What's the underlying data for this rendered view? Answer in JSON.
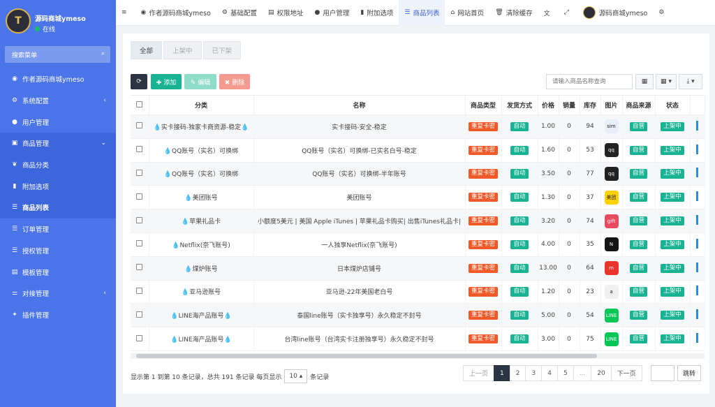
{
  "sidebar": {
    "username": "源码商城ymeso",
    "status": "在线",
    "search_placeholder": "搜索菜单",
    "items": [
      {
        "label": "作者源码商城ymeso",
        "icon": "dashboard-icon",
        "glyph": "◉"
      },
      {
        "label": "系统配置",
        "icon": "gear-icon",
        "glyph": "⚙",
        "chevron": "‹"
      },
      {
        "label": "用户管理",
        "icon": "user-icon",
        "glyph": "●"
      },
      {
        "label": "商品管理",
        "icon": "cart-icon",
        "glyph": "▣",
        "chevron": "⌄"
      },
      {
        "label": "商品分类",
        "icon": "leaf-icon",
        "glyph": "❦"
      },
      {
        "label": "附加选项",
        "icon": "bookmark-icon",
        "glyph": "▮"
      },
      {
        "label": "商品列表",
        "icon": "list-icon",
        "glyph": "☰"
      },
      {
        "label": "订单管理",
        "icon": "order-icon",
        "glyph": "☰"
      },
      {
        "label": "授权管理",
        "icon": "license-icon",
        "glyph": "☰"
      },
      {
        "label": "模板管理",
        "icon": "template-icon",
        "glyph": "▤"
      },
      {
        "label": "对接管理",
        "icon": "sliders-icon",
        "glyph": "⚌",
        "chevron": "‹"
      },
      {
        "label": "插件管理",
        "icon": "plugin-icon",
        "glyph": "✦"
      }
    ]
  },
  "topbar": {
    "items": [
      {
        "label": "",
        "icon": "menu-icon",
        "glyph": "≡"
      },
      {
        "label": "作者源码商城ymeso",
        "icon": "dashboard-icon",
        "glyph": "◉"
      },
      {
        "label": "基础配置",
        "icon": "gear-icon",
        "glyph": "⚙"
      },
      {
        "label": "权限地址",
        "icon": "list-icon",
        "glyph": "▤"
      },
      {
        "label": "用户管理",
        "icon": "user-icon",
        "glyph": "●"
      },
      {
        "label": "附加选项",
        "icon": "bookmark-icon",
        "glyph": "▮"
      },
      {
        "label": "商品列表",
        "icon": "list-icon",
        "glyph": "☰"
      },
      {
        "label": "网站首页",
        "icon": "home-icon",
        "glyph": "⌂"
      },
      {
        "label": "清除缓存",
        "icon": "trash-icon",
        "glyph": "🗑"
      },
      {
        "label": "",
        "icon": "translate-icon",
        "glyph": "文"
      },
      {
        "label": "",
        "icon": "fullscreen-icon",
        "glyph": "⤢"
      },
      {
        "label": "源码商城ymeso",
        "icon": "avatar-icon",
        "glyph": ""
      },
      {
        "label": "",
        "icon": "settings-icon",
        "glyph": "⚙"
      }
    ]
  },
  "tabs": [
    "全部",
    "上架中",
    "已下架"
  ],
  "toolbar": {
    "refresh": "⟳",
    "add": "✚ 添加",
    "edit": "✎ 编辑",
    "delete": "✖ 删除",
    "search_placeholder": "请输入商品名称查询",
    "view_icon": "▦",
    "columns_icon": "▦ ▾",
    "export_icon": "⤓ ▾"
  },
  "table": {
    "headers": [
      "分类",
      "名称",
      "商品类型",
      "发货方式",
      "价格",
      "销量",
      "库存",
      "图片",
      "商品来源",
      "状态"
    ],
    "rows": [
      {
        "category": "💧实卡接码-独家卡商资源-稳定💧",
        "name": "实卡接码-安全-稳定",
        "type": "重复卡密",
        "ship": "自动",
        "price": "1.00",
        "sales": "0",
        "stock": "94",
        "img": "sim",
        "img_color": "#e8eef8",
        "source": "自营",
        "status": "上架中"
      },
      {
        "category": "💧QQ账号（实名）可换绑",
        "name": "QQ账号（实名）可换绑-已实名白号-稳定",
        "type": "重复卡密",
        "ship": "自动",
        "price": "1.60",
        "sales": "0",
        "stock": "53",
        "img": "qq",
        "img_color": "#222",
        "source": "自营",
        "status": "上架中"
      },
      {
        "category": "💧QQ账号（实名）可换绑",
        "name": "QQ账号（实名）可换绑-半年账号",
        "type": "重复卡密",
        "ship": "自动",
        "price": "3.50",
        "sales": "0",
        "stock": "77",
        "img": "qq",
        "img_color": "#222",
        "source": "自营",
        "status": "上架中"
      },
      {
        "category": "💧美团账号",
        "name": "美团账号",
        "type": "重复卡密",
        "ship": "自动",
        "price": "1.30",
        "sales": "0",
        "stock": "37",
        "img": "美团",
        "img_color": "#ffd100",
        "source": "自营",
        "status": "上架中"
      },
      {
        "category": "💧苹果礼品卡",
        "name": "小额度5美元 | 美国 Apple iTunes | 苹果礼品卡购买| 出售iTunes礼品卡|",
        "type": "重复卡密",
        "ship": "自动",
        "price": "3.20",
        "sales": "0",
        "stock": "74",
        "img": "gift",
        "img_color": "#e84a5f",
        "source": "自营",
        "status": "上架中"
      },
      {
        "category": "💧Netflix(奈飞账号)",
        "name": "一人独享Netflix(奈飞账号)",
        "type": "重复卡密",
        "ship": "自动",
        "price": "4.00",
        "sales": "0",
        "stock": "35",
        "img": "N",
        "img_color": "#141414",
        "source": "自营",
        "status": "上架中"
      },
      {
        "category": "💧煤炉账号",
        "name": "日本煤炉店铺号",
        "type": "重复卡密",
        "ship": "自动",
        "price": "13.00",
        "sales": "0",
        "stock": "64",
        "img": "m",
        "img_color": "#ea352d",
        "source": "自营",
        "status": "上架中"
      },
      {
        "category": "💧亚马逊账号",
        "name": "亚马逊-22年美国老白号",
        "type": "重复卡密",
        "ship": "自动",
        "price": "1.20",
        "sales": "0",
        "stock": "23",
        "img": "a",
        "img_color": "#f0f0f0",
        "source": "自营",
        "status": "上架中"
      },
      {
        "category": "💧LINE海产品账号💧",
        "name": "泰国line账号（实卡独享号）永久稳定不封号",
        "type": "重复卡密",
        "ship": "自动",
        "price": "5.00",
        "sales": "0",
        "stock": "54",
        "img": "LINE",
        "img_color": "#06c755",
        "source": "自营",
        "status": "上架中"
      },
      {
        "category": "💧LINE海产品账号💧",
        "name": "台湾line账号（台湾实卡注册独享号）永久稳定不封号",
        "type": "重复卡密",
        "ship": "自动",
        "price": "3.00",
        "sales": "0",
        "stock": "75",
        "img": "LINE",
        "img_color": "#06c755",
        "source": "自营",
        "status": "上架中"
      }
    ]
  },
  "footer": {
    "summary": "显示第 1 到第 10 条记录，总共 191 条记录 每页显示",
    "page_size": "10 ▴",
    "suffix": "条记录"
  },
  "pager": {
    "prev": "上一页",
    "pages": [
      "1",
      "2",
      "3",
      "4",
      "5",
      "...",
      "20"
    ],
    "next": "下一页",
    "go": "跳转"
  }
}
